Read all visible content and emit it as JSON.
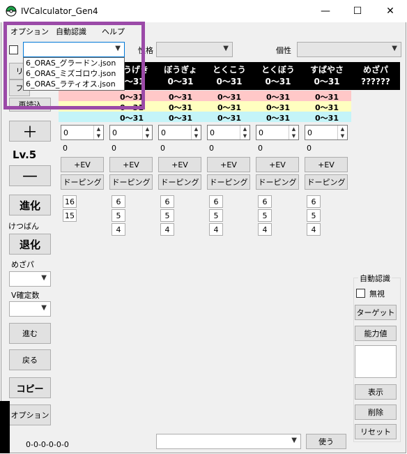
{
  "window": {
    "title": "IVCalculator_Gen4",
    "minimize": "—",
    "maximize": "☐",
    "close": "✕"
  },
  "menu": [
    "オプション",
    "自動認識",
    "ヘルプ"
  ],
  "top": {
    "nature_label": "性格",
    "ability_label": "個性"
  },
  "dropdown_items": [
    "6_ORAS_グラードン.json",
    "6_ORAS_ミズゴロウ.json",
    "6_ORAS_ラティオス.json"
  ],
  "stats": [
    {
      "name": "こうげき",
      "range": "0～31"
    },
    {
      "name": "ぼうぎょ",
      "range": "0～31"
    },
    {
      "name": "とくこう",
      "range": "0～31"
    },
    {
      "name": "とくぼう",
      "range": "0～31"
    },
    {
      "name": "すばやさ",
      "range": "0～31"
    }
  ],
  "mezapa_header": {
    "name": "めざパ",
    "value": "??????"
  },
  "bands": {
    "pink": [
      "0～31",
      "0～31",
      "0～31",
      "0～31",
      "0～31"
    ],
    "yellow": [
      "0～31",
      "0～31",
      "0～31",
      "0～31",
      "0～31"
    ],
    "cyan": [
      "0～31",
      "0～31",
      "0～31",
      "0～31",
      "0～31"
    ]
  },
  "left": {
    "btn_r": "リ",
    "btn_f": "フ",
    "reload": "再読込",
    "plus": "＋",
    "level": "Lv.5",
    "minus": "—",
    "evolve": "進化",
    "ketsuban": "けつばん",
    "devolve": "退化",
    "mezapa": "めざパ",
    "vcount": "V確定数",
    "forward": "進む",
    "back": "戻る",
    "copy": "コピー",
    "option": "オプション",
    "result": "0-0-0-0-0-0"
  },
  "ev": {
    "spin_value": "0",
    "ev_value": "0",
    "ev_button": "+EV",
    "doping_button": "ドーピング"
  },
  "hp_nums": [
    "16",
    "15"
  ],
  "stat_nums": [
    "6",
    "5",
    "4"
  ],
  "right": {
    "group_title": "自動認識",
    "ignore": "無視",
    "target": "ターゲット",
    "ability": "能力値",
    "show": "表示",
    "delete": "削除",
    "reset": "リセット",
    "use": "使う"
  }
}
